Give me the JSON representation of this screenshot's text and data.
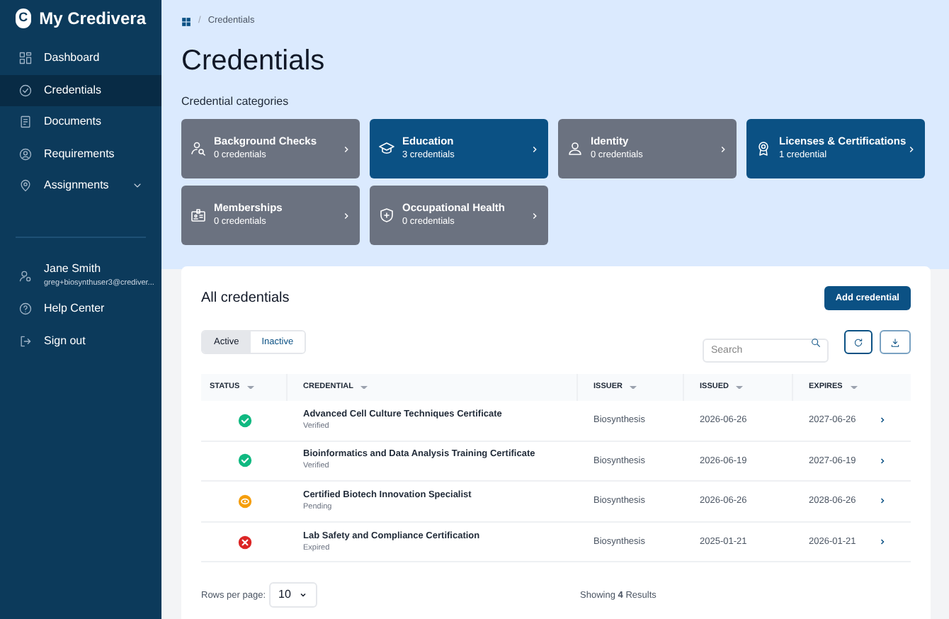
{
  "brand": {
    "logo": "C",
    "name": "My Credivera"
  },
  "nav": [
    {
      "label": "Dashboard",
      "selected": false
    },
    {
      "label": "Credentials",
      "selected": true
    },
    {
      "label": "Documents",
      "selected": false
    },
    {
      "label": "Requirements",
      "selected": false
    },
    {
      "label": "Assignments",
      "selected": false,
      "expandable": true
    }
  ],
  "user": {
    "name": "Jane Smith",
    "email": "greg+biosynthuser3@crediver..."
  },
  "footer_nav": [
    {
      "label": "Help Center"
    },
    {
      "label": "Sign out"
    }
  ],
  "breadcrumb": {
    "separator": "/",
    "items": [
      "Credentials"
    ]
  },
  "title": "Credentials",
  "categories_heading": "Credential categories",
  "categories": [
    {
      "name": "Background Checks",
      "count": "0 credentials",
      "color": "#6b7280"
    },
    {
      "name": "Education",
      "count": "3 credentials",
      "color": "#0b5184"
    },
    {
      "name": "Identity",
      "count": "0 credentials",
      "color": "#6b7280"
    },
    {
      "name": "Licenses & Certifications",
      "count": "1 credential",
      "color": "#0b5184"
    },
    {
      "name": "Memberships",
      "count": "0 credentials",
      "color": "#6b7280"
    },
    {
      "name": "Occupational Health",
      "count": "0 credentials",
      "color": "#6b7280"
    }
  ],
  "panel": {
    "title": "All credentials",
    "add_button": "Add credential",
    "filters": [
      {
        "label": "Active",
        "selected": true
      },
      {
        "label": "Inactive",
        "selected": false
      }
    ],
    "search": {
      "placeholder": "Search"
    },
    "columns": [
      "STATUS",
      "CREDENTIAL",
      "ISSUER",
      "ISSUED",
      "EXPIRES"
    ],
    "rows": [
      {
        "kind": "verified",
        "credential": "Advanced Cell Culture Techniques Certificate",
        "status": "Verified",
        "issuer": "Biosynthesis",
        "issued": "2026-06-26",
        "expires": "2027-06-26"
      },
      {
        "kind": "verified",
        "credential": "Bioinformatics and Data Analysis Training Certificate",
        "status": "Verified",
        "issuer": "Biosynthesis",
        "issued": "2026-06-19",
        "expires": "2027-06-19"
      },
      {
        "kind": "pending",
        "credential": "Certified Biotech Innovation Specialist",
        "status": "Pending",
        "issuer": "Biosynthesis",
        "issued": "2026-06-26",
        "expires": "2028-06-26"
      },
      {
        "kind": "expired",
        "credential": "Lab Safety and Compliance Certification",
        "status": "Expired",
        "issuer": "Biosynthesis",
        "issued": "2025-01-21",
        "expires": "2026-01-21"
      }
    ],
    "rows_per_page_label": "Rows per page:",
    "rows_per_page": "10",
    "results": "Showing **4** Results"
  }
}
